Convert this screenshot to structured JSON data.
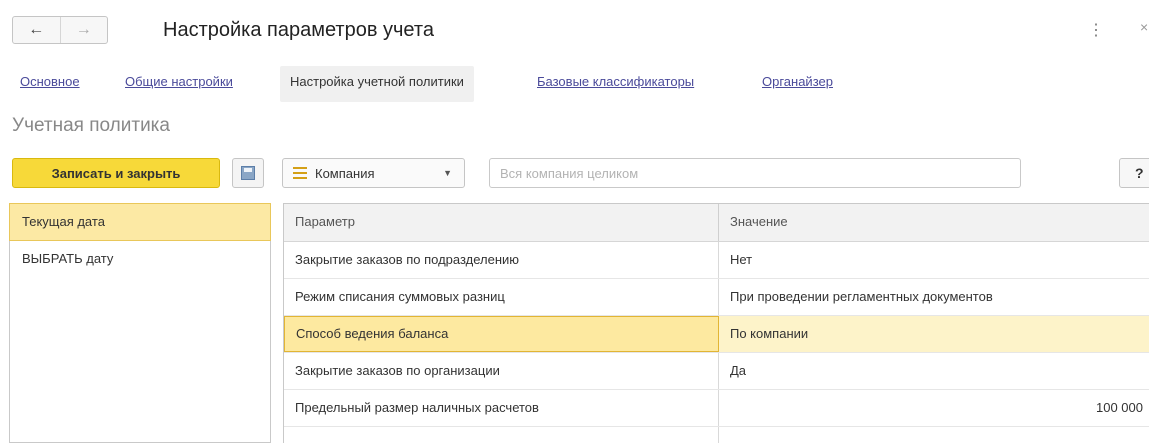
{
  "window": {
    "title": "Настройка параметров учета",
    "back_icon": "←",
    "forward_icon": "→",
    "more_icon": "⋮",
    "close_icon": "×"
  },
  "tabs": [
    {
      "label": "Основное"
    },
    {
      "label": "Общие настройки"
    },
    {
      "label": "Настройка учетной политики",
      "active": true
    },
    {
      "label": "Базовые классификаторы"
    },
    {
      "label": "Органайзер"
    }
  ],
  "section_title": "Учетная политика",
  "toolbar": {
    "save_close_label": "Записать и закрыть",
    "scope_select_value": "Компания",
    "scope_caret": "▼",
    "filter_placeholder": "Вся компания целиком",
    "help_label": "?"
  },
  "date_list": [
    {
      "label": "Текущая дата",
      "selected": true
    },
    {
      "label": "ВЫБРАТЬ дату"
    }
  ],
  "table": {
    "headers": {
      "param": "Параметр",
      "value": "Значение"
    },
    "rows": [
      {
        "param": "Закрытие заказов по подразделению",
        "value": "Нет"
      },
      {
        "param": "Режим списания суммовых разниц",
        "value": "При проведении регламентных документов"
      },
      {
        "param": "Способ ведения баланса",
        "value": "По компании",
        "selected": true
      },
      {
        "param": "Закрытие заказов по организации",
        "value": "Да"
      },
      {
        "param": "Предельный размер наличных расчетов",
        "value": "100 000",
        "numeric": true
      }
    ]
  },
  "colors": {
    "accent_button": "#f7d939",
    "selection": "#fde9a0",
    "link": "#4a4a9a"
  }
}
